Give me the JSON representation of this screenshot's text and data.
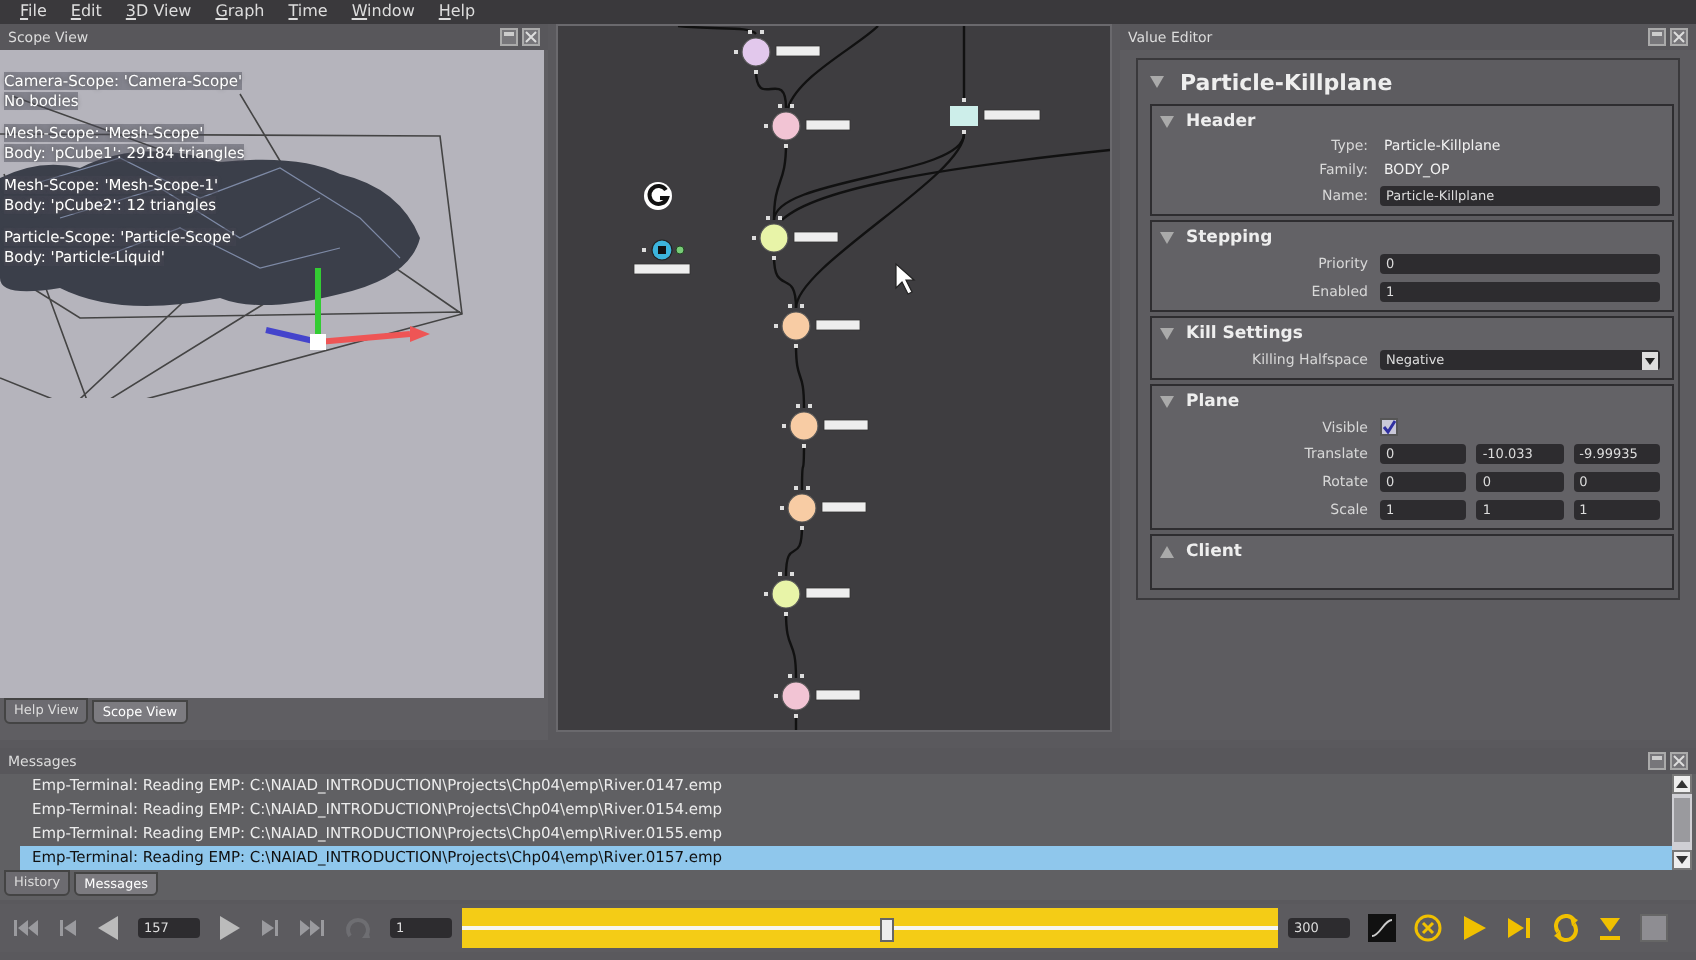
{
  "menu": [
    "File",
    "Edit",
    "3D View",
    "Graph",
    "Time",
    "Window",
    "Help"
  ],
  "scope_view": {
    "title": "Scope View",
    "overlay_groups": [
      [
        "Camera-Scope: 'Camera-Scope'",
        "No bodies"
      ],
      [
        "Mesh-Scope: 'Mesh-Scope'",
        "Body: 'pCube1': 29184 triangles"
      ],
      [
        "Mesh-Scope: 'Mesh-Scope-1'",
        "Body: 'pCube2': 12 triangles"
      ],
      [
        "Particle-Scope: 'Particle-Scope'",
        "Body: 'Particle-Liquid'"
      ]
    ],
    "tabs": [
      {
        "label": "Help View",
        "selected": false
      },
      {
        "label": "Scope View",
        "selected": true
      }
    ]
  },
  "graph": {
    "nodes": [
      {
        "kind": "circle",
        "color": "#e2c8ec"
      },
      {
        "kind": "circle",
        "color": "#f2c4d4"
      },
      {
        "kind": "box",
        "color": "#cdeeea"
      },
      {
        "kind": "circle",
        "color": "#e8f4a8"
      },
      {
        "kind": "circle",
        "color": "#f8cca4"
      },
      {
        "kind": "circle",
        "color": "#f8cca4"
      },
      {
        "kind": "circle",
        "color": "#f8cca4"
      },
      {
        "kind": "circle",
        "color": "#e8f4a8"
      },
      {
        "kind": "circle",
        "color": "#f2c4d4"
      },
      {
        "kind": "scope",
        "color": "#3cb4dc"
      }
    ]
  },
  "value_editor": {
    "title": "Value Editor",
    "node_title": "Particle-Killplane",
    "expanded": true,
    "sections": [
      {
        "title": "Header",
        "expanded": true,
        "rows": [
          {
            "kind": "text",
            "label": "Type:",
            "value": "Particle-Killplane"
          },
          {
            "kind": "text",
            "label": "Family:",
            "value": "BODY_OP"
          },
          {
            "kind": "field",
            "label": "Name:",
            "value": "Particle-Killplane"
          }
        ]
      },
      {
        "title": "Stepping",
        "expanded": true,
        "rows": [
          {
            "kind": "field",
            "label": "Priority",
            "value": "0"
          },
          {
            "kind": "field",
            "label": "Enabled",
            "value": "1"
          }
        ]
      },
      {
        "title": "Kill Settings",
        "expanded": true,
        "rows": [
          {
            "kind": "dropdown",
            "label": "Killing Halfspace",
            "value": "Negative"
          }
        ]
      },
      {
        "title": "Plane",
        "expanded": true,
        "rows": [
          {
            "kind": "checkbox",
            "label": "Visible",
            "checked": true
          },
          {
            "kind": "vector",
            "label": "Translate",
            "values": [
              "0",
              "-10.033",
              "-9.99935"
            ]
          },
          {
            "kind": "vector",
            "label": "Rotate",
            "values": [
              "0",
              "0",
              "0"
            ]
          },
          {
            "kind": "vector",
            "label": "Scale",
            "values": [
              "1",
              "1",
              "1"
            ]
          }
        ]
      },
      {
        "title": "Client",
        "expanded": false
      }
    ]
  },
  "messages": {
    "title": "Messages",
    "lines": [
      {
        "text": "Emp-Terminal: Reading EMP: C:\\NAIAD_INTRODUCTION\\Projects\\Chp04\\emp\\River.0147.emp",
        "selected": false
      },
      {
        "text": "Emp-Terminal: Reading EMP: C:\\NAIAD_INTRODUCTION\\Projects\\Chp04\\emp\\River.0154.emp",
        "selected": false
      },
      {
        "text": "Emp-Terminal: Reading EMP: C:\\NAIAD_INTRODUCTION\\Projects\\Chp04\\emp\\River.0155.emp",
        "selected": false
      },
      {
        "text": "Emp-Terminal: Reading EMP: C:\\NAIAD_INTRODUCTION\\Projects\\Chp04\\emp\\River.0157.emp",
        "selected": true
      }
    ],
    "tabs": [
      {
        "label": "History",
        "selected": false
      },
      {
        "label": "Messages",
        "selected": true
      }
    ]
  },
  "timeline": {
    "current_frame": "157",
    "start_frame": "1",
    "end_frame": "300",
    "level": 0.52
  }
}
